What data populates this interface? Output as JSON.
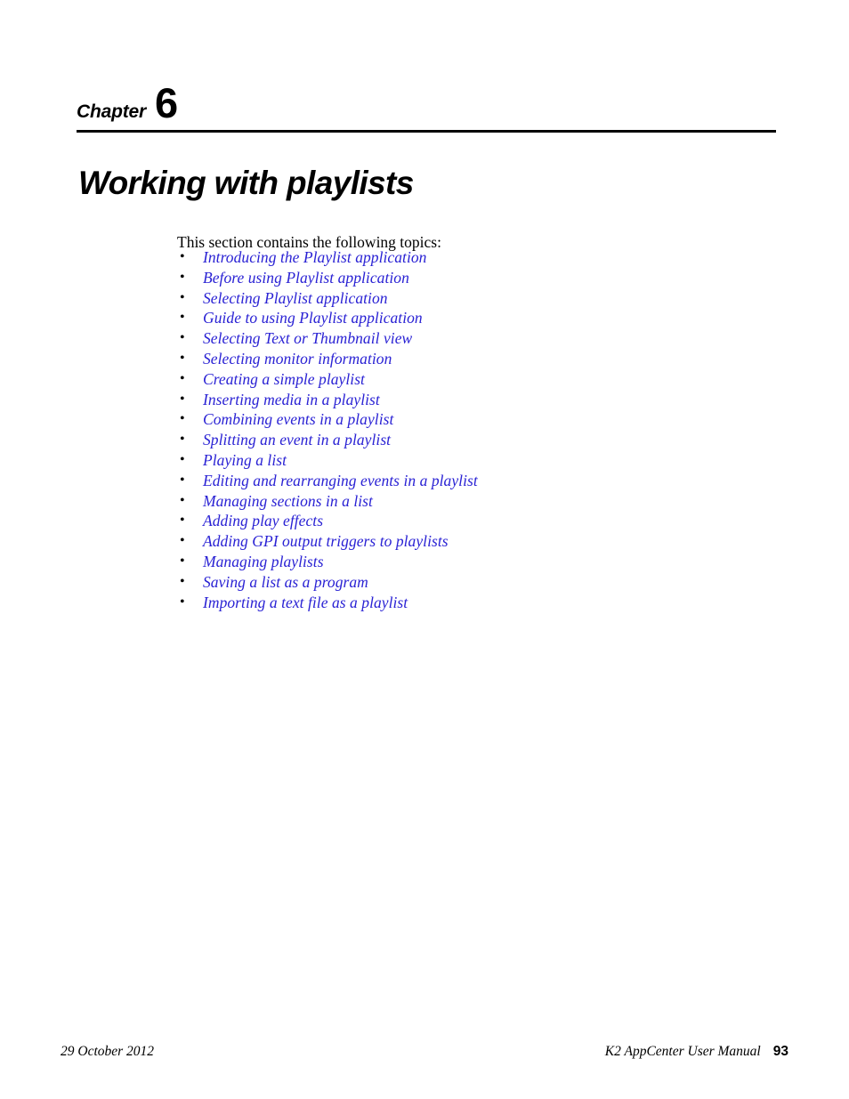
{
  "chapter": {
    "label": "Chapter",
    "number": "6",
    "title": "Working with playlists"
  },
  "body": {
    "intro": "This section contains the following topics:",
    "bullet_glyph": "•",
    "link_color": "#2a22d4",
    "topics": [
      {
        "label": "Introducing the Playlist application"
      },
      {
        "label": "Before using Playlist application"
      },
      {
        "label": "Selecting Playlist application"
      },
      {
        "label": "Guide to using Playlist application"
      },
      {
        "label": "Selecting Text or Thumbnail view"
      },
      {
        "label": "Selecting monitor information"
      },
      {
        "label": "Creating a simple playlist"
      },
      {
        "label": "Inserting media in a playlist"
      },
      {
        "label": "Combining events in a playlist"
      },
      {
        "label": "Splitting an event in a playlist"
      },
      {
        "label": "Playing a list"
      },
      {
        "label": "Editing and rearranging events in a playlist"
      },
      {
        "label": "Managing sections in a list"
      },
      {
        "label": "Adding play effects"
      },
      {
        "label": "Adding GPI output triggers to playlists"
      },
      {
        "label": "Managing playlists"
      },
      {
        "label": "Saving a list as a program"
      },
      {
        "label": "Importing a text file as a playlist"
      }
    ]
  },
  "footer": {
    "date": "29 October 2012",
    "manual_title": "K2 AppCenter User Manual",
    "page_number": "93"
  }
}
